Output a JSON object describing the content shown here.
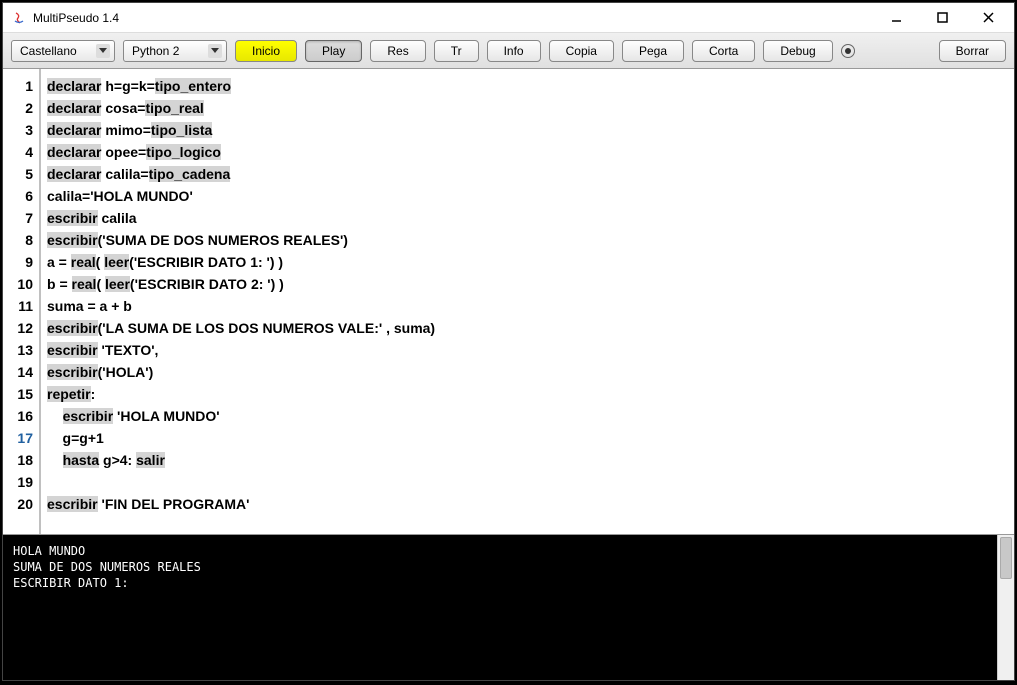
{
  "window": {
    "title": "MultiPseudo 1.4"
  },
  "toolbar": {
    "lang_dropdown": "Castellano",
    "engine_dropdown": "Python 2",
    "inicio": "Inicio",
    "play": "Play",
    "res": "Res",
    "tr": "Tr",
    "info": "Info",
    "copia": "Copia",
    "pega": "Pega",
    "corta": "Corta",
    "debug": "Debug",
    "borrar": "Borrar"
  },
  "gutter": [
    "1",
    "2",
    "3",
    "4",
    "5",
    "6",
    "7",
    "8",
    "9",
    "10",
    "11",
    "12",
    "13",
    "14",
    "15",
    "16",
    "17",
    "18",
    "19",
    "20"
  ],
  "code": {
    "l1": {
      "a": "declarar",
      "b": " h=g=k=",
      "c": "tipo_entero"
    },
    "l2": {
      "a": "declarar",
      "b": " cosa=",
      "c": "tipo_real"
    },
    "l3": {
      "a": "declarar",
      "b": " mimo=",
      "c": "tipo_lista"
    },
    "l4": {
      "a": "declarar",
      "b": " opee=",
      "c": "tipo_logico"
    },
    "l5": {
      "a": "declarar",
      "b": " calila=",
      "c": "tipo_cadena"
    },
    "l6": "calila='HOLA MUNDO'",
    "l7": {
      "a": "escribir",
      "b": " calila"
    },
    "l8": {
      "a": "escribir",
      "b": "('SUMA DE DOS NUMEROS REALES')"
    },
    "l9": {
      "a": "a = ",
      "b": "real",
      "c": "( ",
      "d": "leer",
      "e": "('ESCRIBIR DATO 1: ') )"
    },
    "l10": {
      "a": "b = ",
      "b": "real",
      "c": "( ",
      "d": "leer",
      "e": "('ESCRIBIR DATO 2: ') )"
    },
    "l11": "suma = a + b",
    "l12": {
      "a": "escribir",
      "b": "('LA SUMA DE LOS DOS NUMEROS VALE:' , suma)"
    },
    "l13": {
      "a": "escribir",
      "b": " 'TEXTO',"
    },
    "l14": {
      "a": "escribir",
      "b": "('HOLA')"
    },
    "l15": {
      "a": "repetir",
      "b": ":"
    },
    "l16": {
      "a": "    ",
      "b": "escribir",
      "c": " 'HOLA MUNDO'"
    },
    "l17": "    g=g+1",
    "l18": {
      "a": "    ",
      "b": "hasta",
      "c": " g>4: ",
      "d": "salir"
    },
    "l19": "",
    "l20": {
      "a": "escribir",
      "b": " 'FIN DEL PROGRAMA'"
    }
  },
  "console": "HOLA MUNDO\nSUMA DE DOS NUMEROS REALES\nESCRIBIR DATO 1: "
}
